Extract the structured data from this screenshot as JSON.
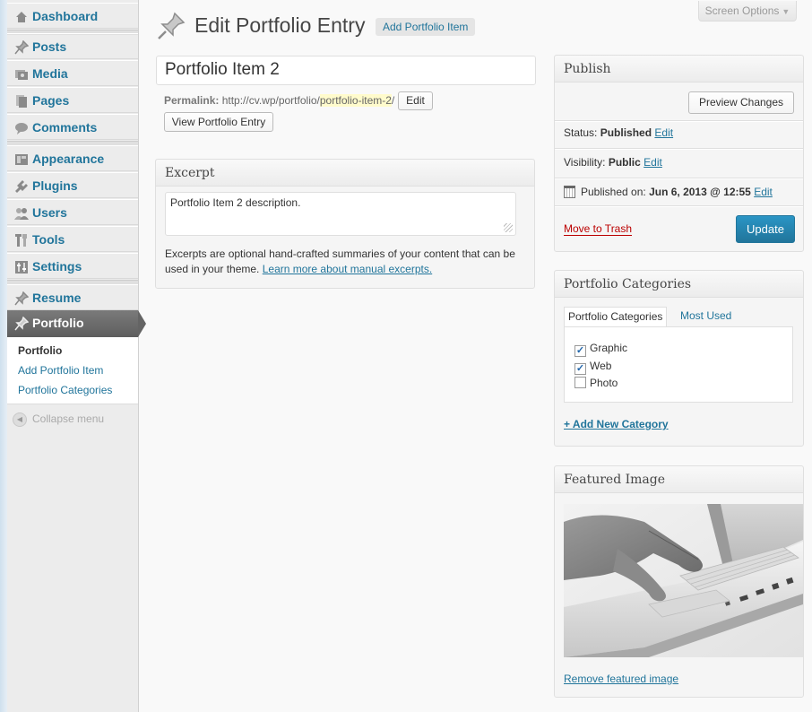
{
  "sidebar": {
    "items": [
      {
        "label": "Dashboard",
        "icon": "dashboard-icon"
      },
      {
        "label": "Posts",
        "icon": "pin-icon"
      },
      {
        "label": "Media",
        "icon": "media-icon"
      },
      {
        "label": "Pages",
        "icon": "pages-icon"
      },
      {
        "label": "Comments",
        "icon": "comment-icon"
      },
      {
        "label": "Appearance",
        "icon": "appearance-icon"
      },
      {
        "label": "Plugins",
        "icon": "plugin-icon"
      },
      {
        "label": "Users",
        "icon": "users-icon"
      },
      {
        "label": "Tools",
        "icon": "tools-icon"
      },
      {
        "label": "Settings",
        "icon": "settings-icon"
      },
      {
        "label": "Resume",
        "icon": "pin-icon"
      },
      {
        "label": "Portfolio",
        "icon": "pin-icon"
      }
    ],
    "submenu": [
      "Portfolio",
      "Add Portfolio Item",
      "Portfolio Categories"
    ],
    "collapse_label": "Collapse menu"
  },
  "header": {
    "title": "Edit Portfolio Entry",
    "add_new_label": "Add Portfolio Item",
    "screen_options_label": "Screen Options"
  },
  "post": {
    "title_value": "Portfolio Item 2",
    "permalink_label": "Permalink:",
    "permalink_base": "http://cv.wp/portfolio/",
    "permalink_slug": "portfolio-item-2",
    "permalink_end": "/",
    "edit_label": "Edit",
    "view_label": "View Portfolio Entry"
  },
  "excerpt": {
    "heading": "Excerpt",
    "value": "Portfolio Item 2 description.",
    "help_text": "Excerpts are optional hand-crafted summaries of your content that can be used in your theme. ",
    "help_link": "Learn more about manual excerpts."
  },
  "publish": {
    "heading": "Publish",
    "preview_label": "Preview Changes",
    "status_label": "Status:",
    "status_value": "Published",
    "visibility_label": "Visibility:",
    "visibility_value": "Public",
    "published_label": "Published on:",
    "published_value": "Jun 6, 2013 @ 12:55",
    "edit_label": "Edit",
    "trash_label": "Move to Trash",
    "update_label": "Update"
  },
  "categories": {
    "heading": "Portfolio Categories",
    "tab_all": "Portfolio Categories",
    "tab_most_used": "Most Used",
    "items": [
      {
        "label": "Graphic",
        "checked": true
      },
      {
        "label": "Web",
        "checked": true
      },
      {
        "label": "Photo",
        "checked": false
      }
    ],
    "add_new_label": "+ Add New Category"
  },
  "featured": {
    "heading": "Featured Image",
    "remove_label": "Remove featured image"
  },
  "colors": {
    "link": "#21759b",
    "update_button": "#21759b",
    "trash": "#bb0000",
    "current_menu": "#646464"
  }
}
